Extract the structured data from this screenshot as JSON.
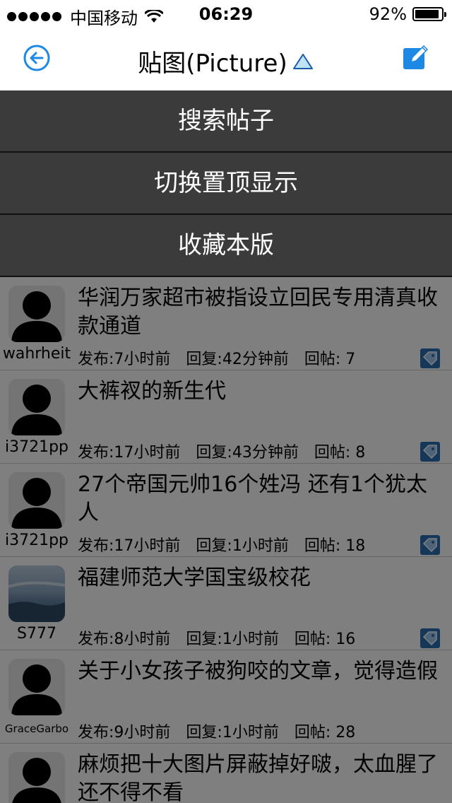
{
  "status_bar": {
    "carrier": "中国移动",
    "time": "06:29",
    "battery": "92%",
    "battery_level": 0.92
  },
  "nav": {
    "title": "贴图(Picture)",
    "back_icon": "arrow-left-circle-icon",
    "compose_icon": "compose-icon"
  },
  "menu": {
    "items": [
      "搜索帖子",
      "切换置顶显示",
      "收藏本版"
    ]
  },
  "posts": [
    {
      "user": "wahrheit",
      "title": "华润万家超市被指设立回民专用清真收款通道",
      "posted": "发布:7小时前",
      "reply": "回复:42分钟前",
      "count": "回帖: 7"
    },
    {
      "user": "i3721pp",
      "title": "大裤衩的新生代",
      "posted": "发布:17小时前",
      "reply": "回复:43分钟前",
      "count": "回帖: 8"
    },
    {
      "user": "i3721pp",
      "title": "27个帝国元帅16个姓冯 还有1个犹太人",
      "posted": "发布:17小时前",
      "reply": "回复:1小时前",
      "count": "回帖: 18"
    },
    {
      "user": "S777",
      "title": "福建师范大学国宝级校花",
      "posted": "发布:8小时前",
      "reply": "回复:1小时前",
      "count": "回帖: 16"
    },
    {
      "user": "GraceGarbo",
      "title": "关于小女孩子被狗咬的文章，觉得造假",
      "posted": "发布:9小时前",
      "reply": "回复:1小时前",
      "count": "回帖: 28"
    },
    {
      "user": "",
      "title": "麻烦把十大图片屏蔽掉好啵，太血腥了还不得不看",
      "posted": "",
      "reply": "",
      "count": ""
    }
  ],
  "colors": {
    "accent": "#1e88e5",
    "menu_bg": "#3b3b3b",
    "overlay": "rgba(0,0,0,0.5)"
  }
}
